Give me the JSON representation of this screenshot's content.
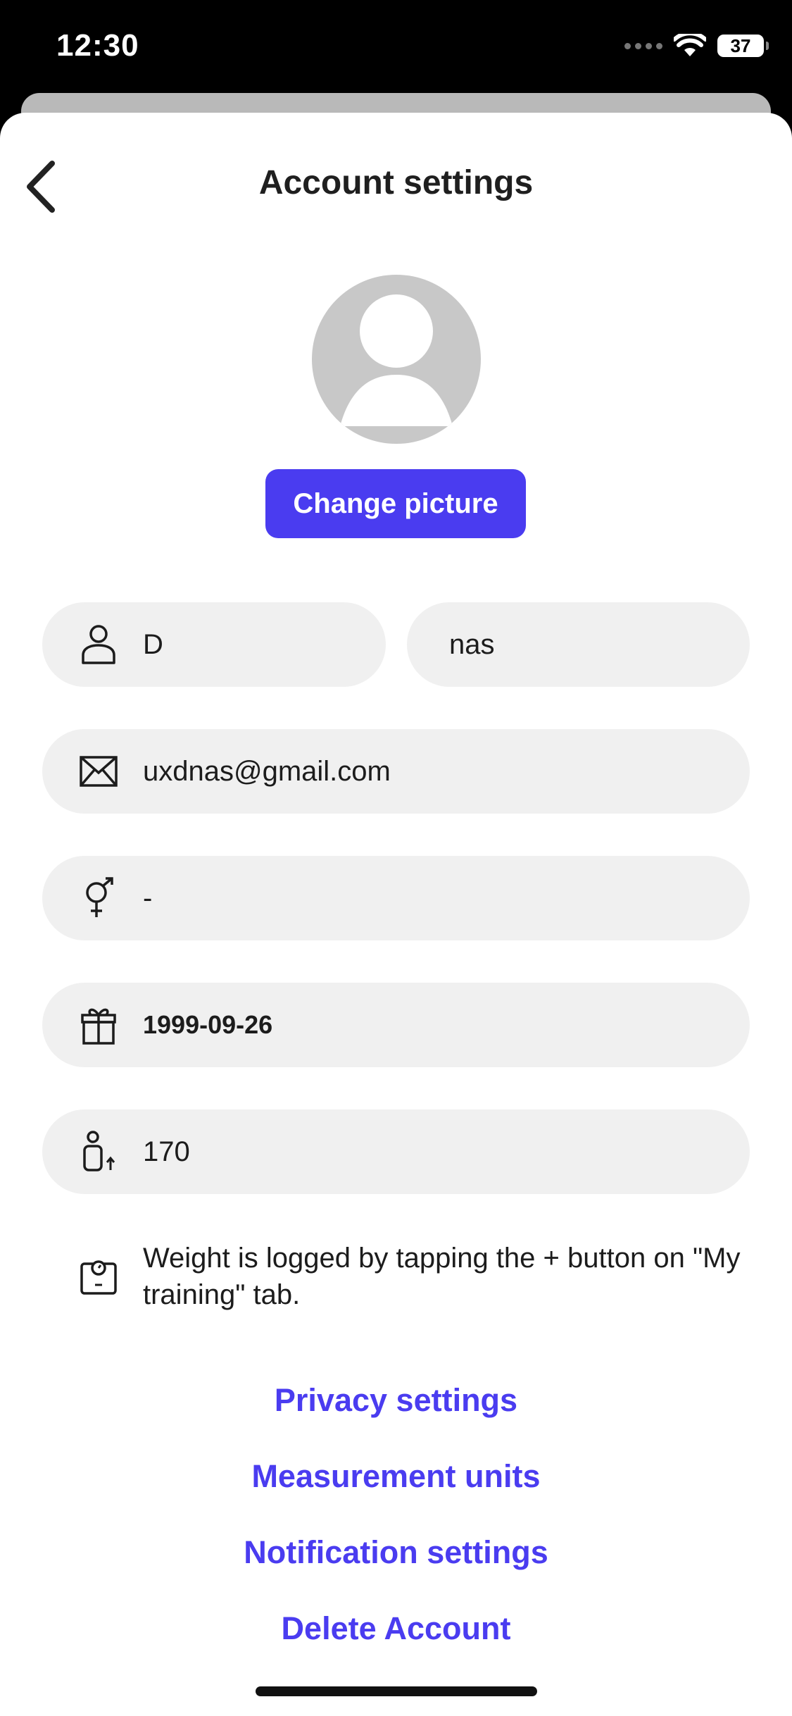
{
  "status_bar": {
    "time": "12:30",
    "battery": "37"
  },
  "header": {
    "title": "Account settings",
    "back_icon": "chevron-left-icon"
  },
  "profile": {
    "avatar_icon": "user-placeholder-icon",
    "change_picture_label": "Change picture"
  },
  "fields": {
    "first_name": "D",
    "last_name": "nas",
    "email": "uxdnas@gmail.com",
    "gender": "-",
    "birthday": "1999-09-26",
    "height": "170"
  },
  "weight_info": {
    "icon": "scale-icon",
    "text": "Weight is logged by tapping the + button on \"My training\" tab."
  },
  "links": {
    "privacy": "Privacy settings",
    "units": "Measurement units",
    "notifications": "Notification settings",
    "delete": "Delete Account"
  },
  "colors": {
    "accent": "#4a3cf0",
    "field_bg": "#f0f0f0",
    "avatar_bg": "#c8c8c8"
  }
}
